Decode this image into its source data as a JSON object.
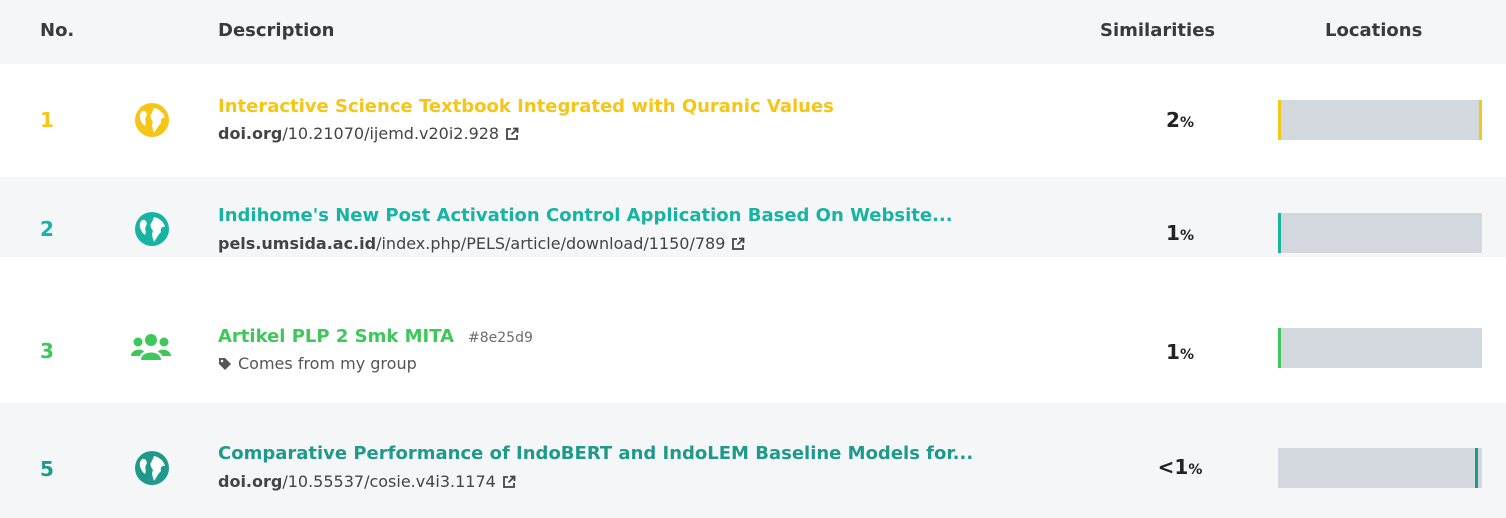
{
  "header": {
    "no": "No.",
    "description": "Description",
    "similarities": "Similarities",
    "locations": "Locations"
  },
  "rows": [
    {
      "number": "1",
      "icon": "globe-icon",
      "color": "#f5c518",
      "title": "Interactive Science Textbook Integrated with Quranic Values",
      "source_domain": "doi.org",
      "source_path": "/10.21070/ijemd.v20i2.928",
      "percent": "2",
      "percent_sign": "%",
      "locations": [
        0.0,
        1.0
      ]
    },
    {
      "number": "2",
      "icon": "globe-icon",
      "color": "#17b3a3",
      "title": "Indihome's New Post Activation Control Application Based On Website...",
      "source_domain": "pels.umsida.ac.id",
      "source_path": "/index.php/PELS/article/download/1150/789",
      "percent": "1",
      "percent_sign": "%",
      "locations": [
        0.0
      ]
    },
    {
      "number": "3",
      "icon": "users-icon",
      "color": "#3ec75a",
      "title": "Artikel PLP 2 Smk MITA",
      "hash": "#8e25d9",
      "tag_text": "Comes from my group",
      "percent": "1",
      "percent_sign": "%",
      "locations": [
        0.0
      ]
    },
    {
      "number": "5",
      "icon": "globe-icon",
      "color": "#1f9a8a",
      "title": "Comparative Performance of IndoBERT and IndoLEM Baseline Models for...",
      "source_domain": "doi.org",
      "source_path": "/10.55537/cosie.v4i3.1174",
      "percent": "<1",
      "percent_sign": "%",
      "locations": [
        0.98
      ]
    }
  ]
}
